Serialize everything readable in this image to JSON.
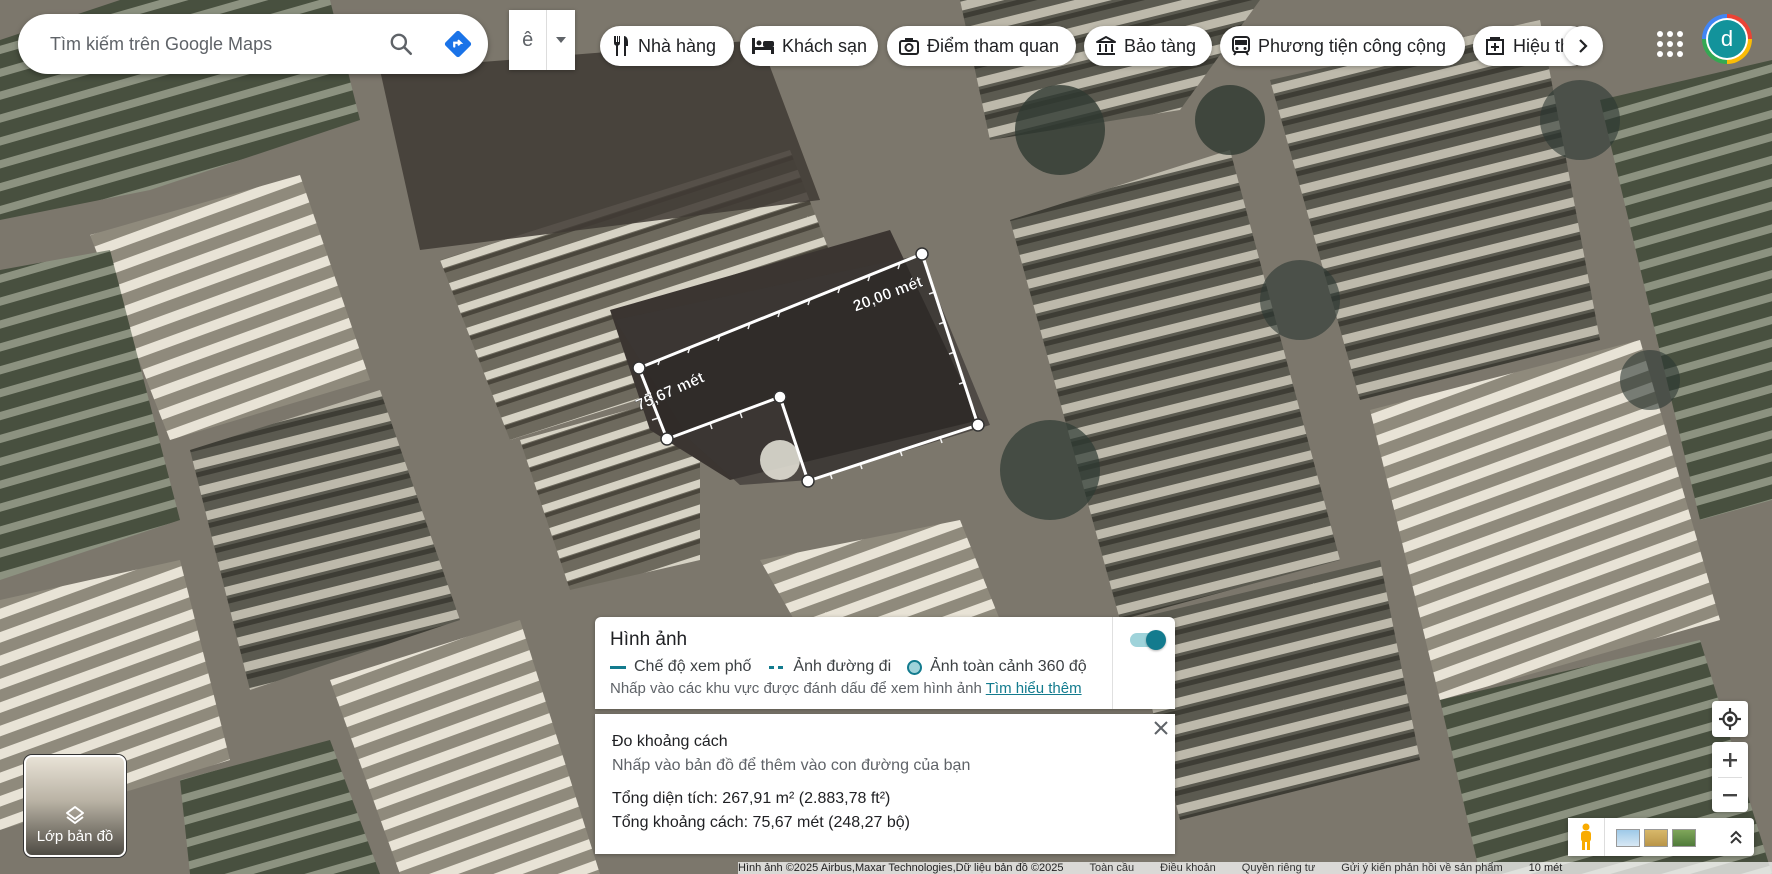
{
  "search": {
    "placeholder": "Tìm kiếm trên Google Maps"
  },
  "language_selector": {
    "value": "ê"
  },
  "chips": [
    {
      "label": "Nhà hàng",
      "icon": "restaurant-icon"
    },
    {
      "label": "Khách sạn",
      "icon": "hotel-icon"
    },
    {
      "label": "Điểm tham quan",
      "icon": "camera-icon"
    },
    {
      "label": "Bảo tàng",
      "icon": "museum-icon"
    },
    {
      "label": "Phương tiện công cộng",
      "icon": "transit-icon"
    },
    {
      "label": "Hiệu th",
      "icon": "pharmacy-icon"
    }
  ],
  "account": {
    "avatar_letter": "d"
  },
  "map": {
    "measure_labels": {
      "top_edge": "20,00 mét",
      "left_edge": "75,67 mét"
    }
  },
  "imagery_panel": {
    "title": "Hình ảnh",
    "legend": {
      "street_view": "Chế độ xem phố",
      "road_photos": "Ảnh đường đi",
      "photo_360": "Ảnh toàn cảnh 360 độ"
    },
    "hint_text": "Nhấp vào các khu vực được đánh dấu để xem hình ảnh",
    "learn_more": "Tìm hiểu thêm",
    "toggle_on": true
  },
  "measure_panel": {
    "title": "Đo khoảng cách",
    "hint": "Nhấp vào bản đồ để thêm vào con đường của bạn",
    "total_area": "Tổng diện tích: 267,91 m² (2.883,78 ft²)",
    "total_distance": "Tổng khoảng cách: 75,67 mét (248,27 bộ)"
  },
  "layers_button": {
    "label": "Lớp bản đồ"
  },
  "footer": {
    "attribution": "Hình ảnh ©2025 Airbus,Maxar Technologies,Dữ liệu bản đồ ©2025",
    "global": "Toàn cầu",
    "terms": "Điều khoản",
    "privacy": "Quyền riêng tư",
    "feedback": "Gửi ý kiến phản hồi về sản phẩm",
    "scale": "10 mét"
  },
  "colors": {
    "accent": "#137b8e",
    "accent_light": "#9fd3da",
    "directions_blue": "#1a73e8"
  }
}
